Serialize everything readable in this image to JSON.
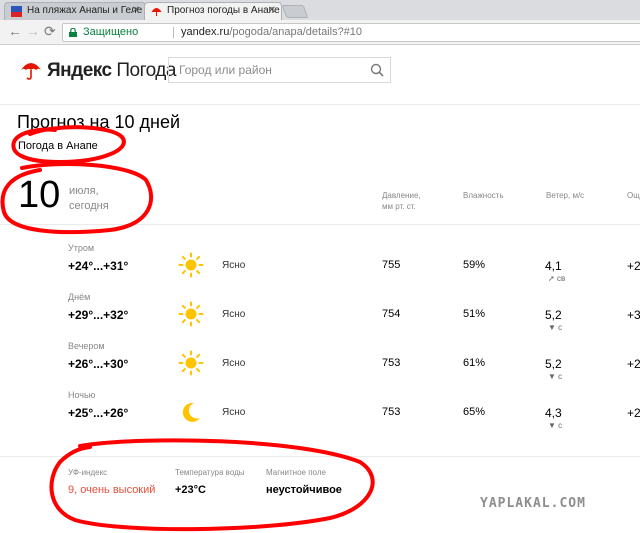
{
  "browser": {
    "tabs": [
      {
        "title": "На пляжах Анапы и Геле"
      },
      {
        "title": "Прогноз погоды в Анапе"
      }
    ],
    "secure_label": "Защищено",
    "url_host": "yandex.ru",
    "url_path": "/pogoda/anapa/details?#10"
  },
  "header": {
    "logo_brand": "Яндекс",
    "logo_product": "Погода",
    "search_placeholder": "Город или район"
  },
  "page": {
    "title": "Прогноз на 10 дней",
    "subtitle": "Погода в Анапе",
    "day": "10",
    "month": "июля,",
    "today": "сегодня"
  },
  "columns": {
    "pressure_line1": "Давление,",
    "pressure_line2": "мм рт. ст.",
    "humidity": "Влажность",
    "wind": "Ветер, м/с",
    "extra": "Ощ"
  },
  "rows": [
    {
      "part": "Утром",
      "temp": "+24°...+31°",
      "icon": "sun-icon",
      "cond": "Ясно",
      "pressure": "755",
      "humidity": "59%",
      "wind": "4,1",
      "dir": "св",
      "extra": "+2"
    },
    {
      "part": "Днём",
      "temp": "+29°...+32°",
      "icon": "sun-icon",
      "cond": "Ясно",
      "pressure": "754",
      "humidity": "51%",
      "wind": "5,2",
      "dir": "с",
      "extra": "+3"
    },
    {
      "part": "Вечером",
      "temp": "+26°...+30°",
      "icon": "sun-icon",
      "cond": "Ясно",
      "pressure": "753",
      "humidity": "61%",
      "wind": "5,2",
      "dir": "с",
      "extra": "+2"
    },
    {
      "part": "Ночью",
      "temp": "+25°...+26°",
      "icon": "moon-icon",
      "cond": "Ясно",
      "pressure": "753",
      "humidity": "65%",
      "wind": "4,3",
      "dir": "с",
      "extra": "+2"
    }
  ],
  "bottom": {
    "uv_label": "УФ-индекс",
    "uv_value": "9, очень высокий",
    "water_label": "Температура воды",
    "water_value": "+23°C",
    "magnetic_label": "Магнитное поле",
    "magnetic_value": "неустойчивое"
  },
  "watermark": "YAPLAKAL.COM",
  "colors": {
    "brand_red": "#e61400",
    "uv_red": "#e8503a",
    "sun": "#ffc300",
    "scribble": "#ff0000"
  }
}
